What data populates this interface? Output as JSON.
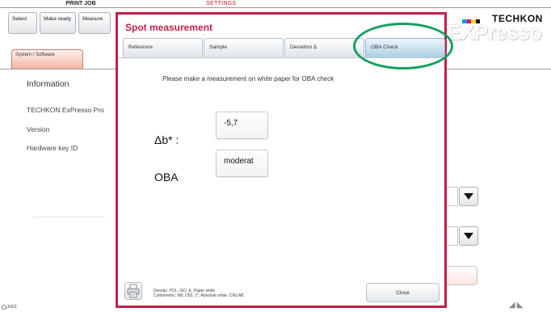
{
  "app": {
    "print_job_label": "PRINT JOB",
    "settings_label": "SETTINGS",
    "logo": {
      "text": "TECHKON",
      "product": "EXPresso",
      "colors": [
        "#00a0e0",
        "#e0007a",
        "#ffe000",
        "#111111"
      ]
    },
    "left_tabs": [
      "Select",
      "Make ready",
      "Measure"
    ],
    "system_tab": "System / Software",
    "info": {
      "heading": "Information",
      "rows": [
        "TECHKON ExPresso Pro",
        "Version",
        "Hardware key ID"
      ]
    },
    "job_label": "Job1"
  },
  "dialog": {
    "title": "Spot measurement",
    "tabs": [
      {
        "label": "Reference",
        "active": false
      },
      {
        "label": "Sample",
        "active": false
      },
      {
        "label": "Deviation Δ",
        "active": false
      },
      {
        "label": "OBA Check",
        "active": true
      }
    ],
    "instruction": "Please make a measurement on white paper for OBA check",
    "delta_b": {
      "label": "Δb* :",
      "value": "-5,7"
    },
    "oba": {
      "label": "OBA",
      "value": "moderat"
    },
    "footer_line1": "Density: POL, ISO_E, Paper white",
    "footer_line2": "Colorimetric: M0, D50, 2°, Absolute white, CIELAB",
    "close_label": "Close",
    "accent_color": "#c41f4b"
  },
  "annotation": {
    "color": "#12a060",
    "target": "OBA Check tab"
  }
}
